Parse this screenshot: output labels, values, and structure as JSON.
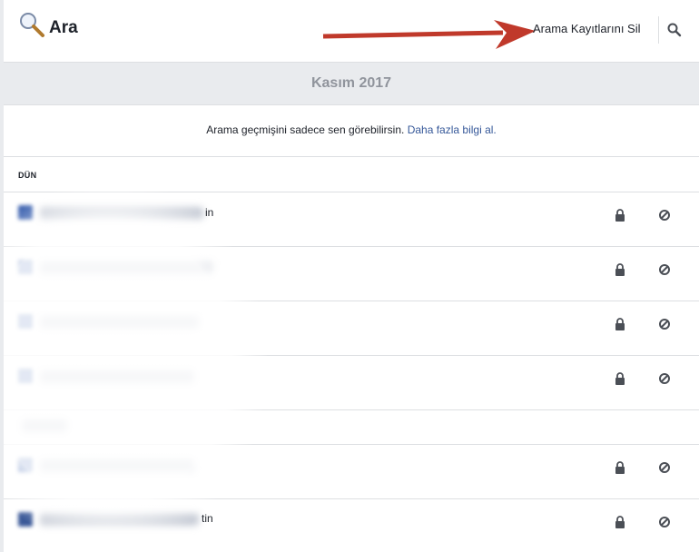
{
  "header": {
    "title": "Ara",
    "clear_label": "Arama Kayıtlarını Sil"
  },
  "month": {
    "label": "Kasım 2017"
  },
  "notice": {
    "text": "Arama geçmişini sadece sen görebilirsin.",
    "link": "Daha fazla bilgi al."
  },
  "day": {
    "label": "DÜN"
  },
  "entries": [
    {
      "suffix": "in"
    },
    {
      "suffix": ""
    },
    {
      "suffix": ""
    },
    {
      "suffix": ""
    },
    {
      "suffix": ""
    },
    {
      "suffix": ""
    },
    {
      "suffix": "tin"
    }
  ],
  "colors": {
    "accent": "#365899",
    "arrow": "#c0392b",
    "brand": "#4267b2"
  },
  "icons": {
    "search": "magnifier-icon",
    "lock": "lock-icon",
    "hide": "hide-circle-icon"
  }
}
